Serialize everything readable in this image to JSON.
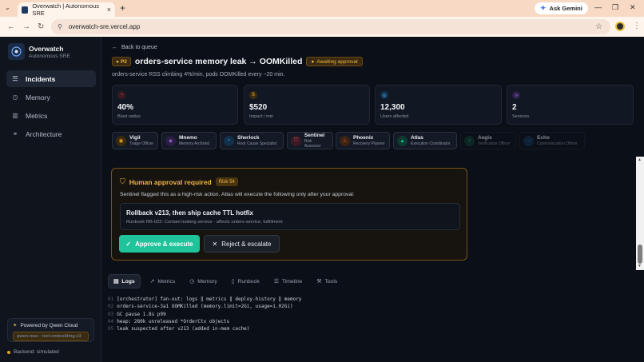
{
  "browser": {
    "tab_title": "Overwatch | Autonomous SRE",
    "tab_close": "×",
    "new_tab": "+",
    "url": "overwatch-sre.vercel.app",
    "ask_gemini": "Ask Gemini"
  },
  "sidebar": {
    "brand_name": "Overwatch",
    "brand_sub": "Autonomous SRE",
    "items": [
      {
        "label": "Incidents",
        "icon": "list-icon",
        "active": true
      },
      {
        "label": "Memory",
        "icon": "memory-icon",
        "active": false
      },
      {
        "label": "Metrics",
        "icon": "bar-chart-icon",
        "active": false
      },
      {
        "label": "Architecture",
        "icon": "network-icon",
        "active": false
      }
    ],
    "powered_by": "Powered by Qwen Cloud",
    "model_info": "qwen-max · text-embedding-v3",
    "backend_status": "Backend: simulated"
  },
  "incident": {
    "back_label": "Back to queue",
    "priority": "P2",
    "title": "orders-service memory leak → OOMKilled",
    "status": "Awaiting approval",
    "subtitle": "orders-service RSS climbing 4%/min, pods OOMKilled every ~20 min."
  },
  "stats": [
    {
      "value": "40%",
      "label": "Blast radius",
      "color": "#e0546b",
      "icon": "gauge-icon"
    },
    {
      "value": "$520",
      "label": "Impact / min",
      "color": "#e0a325",
      "icon": "dollar-icon"
    },
    {
      "value": "12,300",
      "label": "Users affected",
      "color": "#3fa0e6",
      "icon": "users-icon"
    },
    {
      "value": "2",
      "label": "Services",
      "color": "#a47be6",
      "icon": "layers-icon"
    }
  ],
  "agents": [
    {
      "name": "Vigil",
      "role": "Triage Officer",
      "color": "#e0a325",
      "glyph": "◉",
      "dim": false
    },
    {
      "name": "Mnemo",
      "role": "Memory Archivist",
      "color": "#a47be6",
      "glyph": "◈",
      "dim": false
    },
    {
      "name": "Sherlock",
      "role": "Root Cause Specialist",
      "color": "#3fa0e6",
      "glyph": "⌕",
      "dim": false
    },
    {
      "name": "Sentinel",
      "role": "Risk Assessor",
      "color": "#e0546b",
      "glyph": "⛉",
      "dim": false
    },
    {
      "name": "Phoenix",
      "role": "Recovery Planner",
      "color": "#f07a3a",
      "glyph": "♨",
      "dim": false
    },
    {
      "name": "Atlas",
      "role": "Execution Coordinator",
      "color": "#1fc49a",
      "glyph": "▲",
      "dim": false
    },
    {
      "name": "Aegis",
      "role": "Verification Officer",
      "color": "#1fc49a",
      "glyph": "✧",
      "dim": true
    },
    {
      "name": "Echo",
      "role": "Communication Officer",
      "color": "#3fa0e6",
      "glyph": "⋯",
      "dim": true
    }
  ],
  "approval": {
    "title": "Human approval required",
    "risk": "Risk 54",
    "text": "Sentinel flagged this as a high-risk action. Atlas will execute the following only after your approval:",
    "plan_title": "Rollback v213, then ship cache TTL hotfix",
    "plan_detail": "Runbook RB-022: Contain leaking service · affects orders-service, fulfillment",
    "approve_label": "Approve & execute",
    "reject_label": "Reject & escalate"
  },
  "tabs": [
    {
      "label": "Logs",
      "icon": "file-icon",
      "active": true
    },
    {
      "label": "Metrics",
      "icon": "trend-icon",
      "active": false
    },
    {
      "label": "Memory",
      "icon": "memory-icon",
      "active": false
    },
    {
      "label": "Runbook",
      "icon": "book-icon",
      "active": false
    },
    {
      "label": "Timeline",
      "icon": "timeline-icon",
      "active": false
    },
    {
      "label": "Tools",
      "icon": "wrench-icon",
      "active": false
    }
  ],
  "logs": [
    {
      "n": "01",
      "text": "[orchestrator] fan-out: logs ‖ metrics ‖ deploy-history ‖ memory"
    },
    {
      "n": "02",
      "text": "orders-service-3a1 OOMKilled (memory.limit=2Gi, usage=1.02Gi)"
    },
    {
      "n": "03",
      "text": "GC pause 1.8s p99"
    },
    {
      "n": "04",
      "text": "heap: 280k unreleased *OrderCtx objects"
    },
    {
      "n": "05",
      "text": "leak suspected after v213 (added in-mem cache)"
    }
  ]
}
